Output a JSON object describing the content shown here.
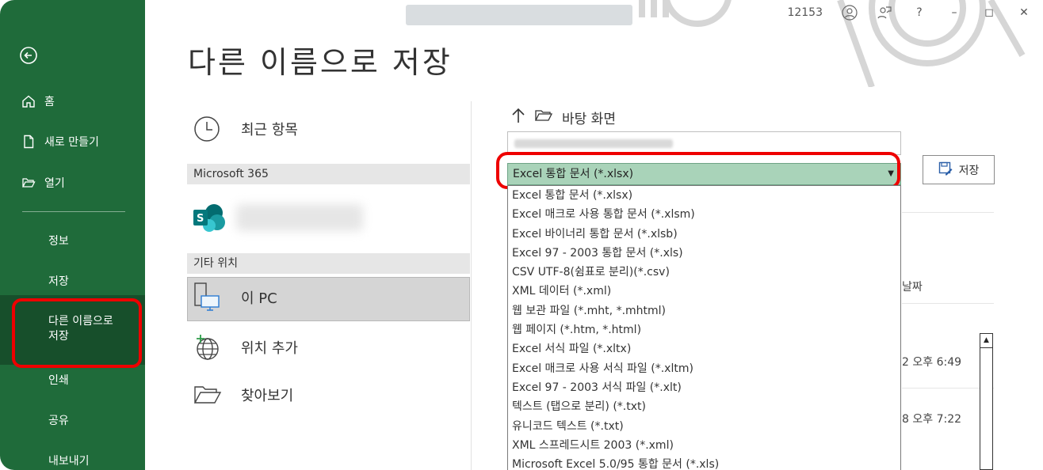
{
  "window": {
    "title_blurred": true,
    "user_id": "12153",
    "controls": {
      "minimize": "–",
      "restore": "◻",
      "close": "✕",
      "help": "?"
    }
  },
  "sidebar": {
    "home": "홈",
    "new": "새로 만들기",
    "open": "열기",
    "info": "정보",
    "save": "저장",
    "save_as": "다른 이름으로\n저장",
    "print": "인쇄",
    "share": "공유",
    "export": "내보내기"
  },
  "page_title": "다른 이름으로 저장",
  "locations": {
    "recent": "최근 항목",
    "group_m365": "Microsoft 365",
    "group_other": "기타 위치",
    "this_pc": "이 PC",
    "add_place": "위치 추가",
    "browse": "찾아보기"
  },
  "path": {
    "folder": "바탕 화면"
  },
  "file_type": {
    "selected": "Excel 통합 문서 (*.xlsx)",
    "options": [
      "Excel 통합 문서 (*.xlsx)",
      "Excel 매크로 사용 통합 문서 (*.xlsm)",
      "Excel 바이너리 통합 문서 (*.xlsb)",
      "Excel 97 - 2003 통합 문서 (*.xls)",
      "CSV UTF-8(쉼표로 분리)(*.csv)",
      "XML 데이터 (*.xml)",
      "웹 보관 파일 (*.mht, *.mhtml)",
      "웹 페이지 (*.htm, *.html)",
      "Excel 서식 파일 (*.xltx)",
      "Excel 매크로 사용 서식 파일 (*.xltm)",
      "Excel 97 - 2003 서식 파일 (*.xlt)",
      "텍스트 (탭으로 분리) (*.txt)",
      "유니코드 텍스트 (*.txt)",
      "XML 스프레드시트 2003 (*.xml)",
      "Microsoft Excel 5.0/95 통합 문서 (*.xls)"
    ]
  },
  "save_button": "저장",
  "background_list": {
    "column_fragment": "날짜",
    "row1_date": "2 오후 6:49",
    "row2_date": "8 오후 7:22"
  },
  "colors": {
    "rail": "#1f6b3a",
    "selected_type": "#a9d3b9",
    "annotation": "#e00000"
  }
}
